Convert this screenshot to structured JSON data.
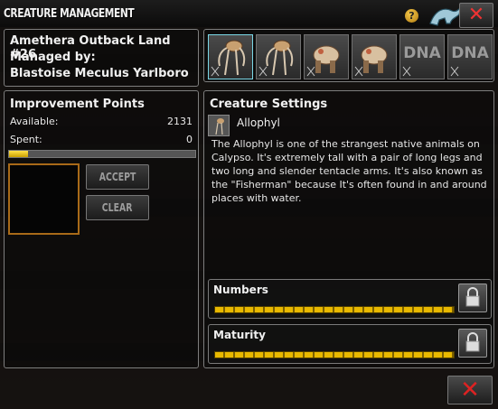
{
  "window": {
    "title": "CREATURE MANAGEMENT"
  },
  "titlebar": {
    "help_glyph": "?",
    "close_glyph": "✕"
  },
  "owner": {
    "land_name": "Amethera Outback Land #26",
    "managed_by_label": "Managed by:",
    "manager_name": "Blastoise Meculus Yarlboro"
  },
  "slots": [
    {
      "kind": "creature",
      "icon": "allophyl-icon",
      "selected": true,
      "text": ""
    },
    {
      "kind": "creature",
      "icon": "allophyl-icon",
      "selected": false,
      "text": ""
    },
    {
      "kind": "creature",
      "icon": "creature-walker-icon",
      "selected": false,
      "text": ""
    },
    {
      "kind": "creature",
      "icon": "creature-walker-icon",
      "selected": false,
      "text": ""
    },
    {
      "kind": "dna",
      "icon": "dna-placeholder",
      "selected": false,
      "text": "DNA"
    },
    {
      "kind": "dna",
      "icon": "dna-placeholder",
      "selected": false,
      "text": "DNA"
    }
  ],
  "improvement": {
    "title": "Improvement Points",
    "available_label": "Available:",
    "available_value": "2131",
    "spent_label": "Spent:",
    "spent_value": "0",
    "progress_fraction": 0.1,
    "accept_label": "ACCEPT",
    "clear_label": "CLEAR"
  },
  "settings": {
    "title": "Creature Settings",
    "species": "Allophyl",
    "description": "The Allophyl is one of the strangest native animals on Calypso. It's extremely tall with a pair of long legs and two long and slender tentacle arms. It's also known as the \"Fisherman\" because It's often found in and around places with water.",
    "numbers_label": "Numbers",
    "maturity_label": "Maturity"
  },
  "footer": {
    "close_glyph": "✕"
  },
  "colors": {
    "accent_yellow": "#e8b800",
    "close_red": "#d22222",
    "selected_cyan": "#7ad7e6",
    "drop_orange": "#a86a18"
  }
}
